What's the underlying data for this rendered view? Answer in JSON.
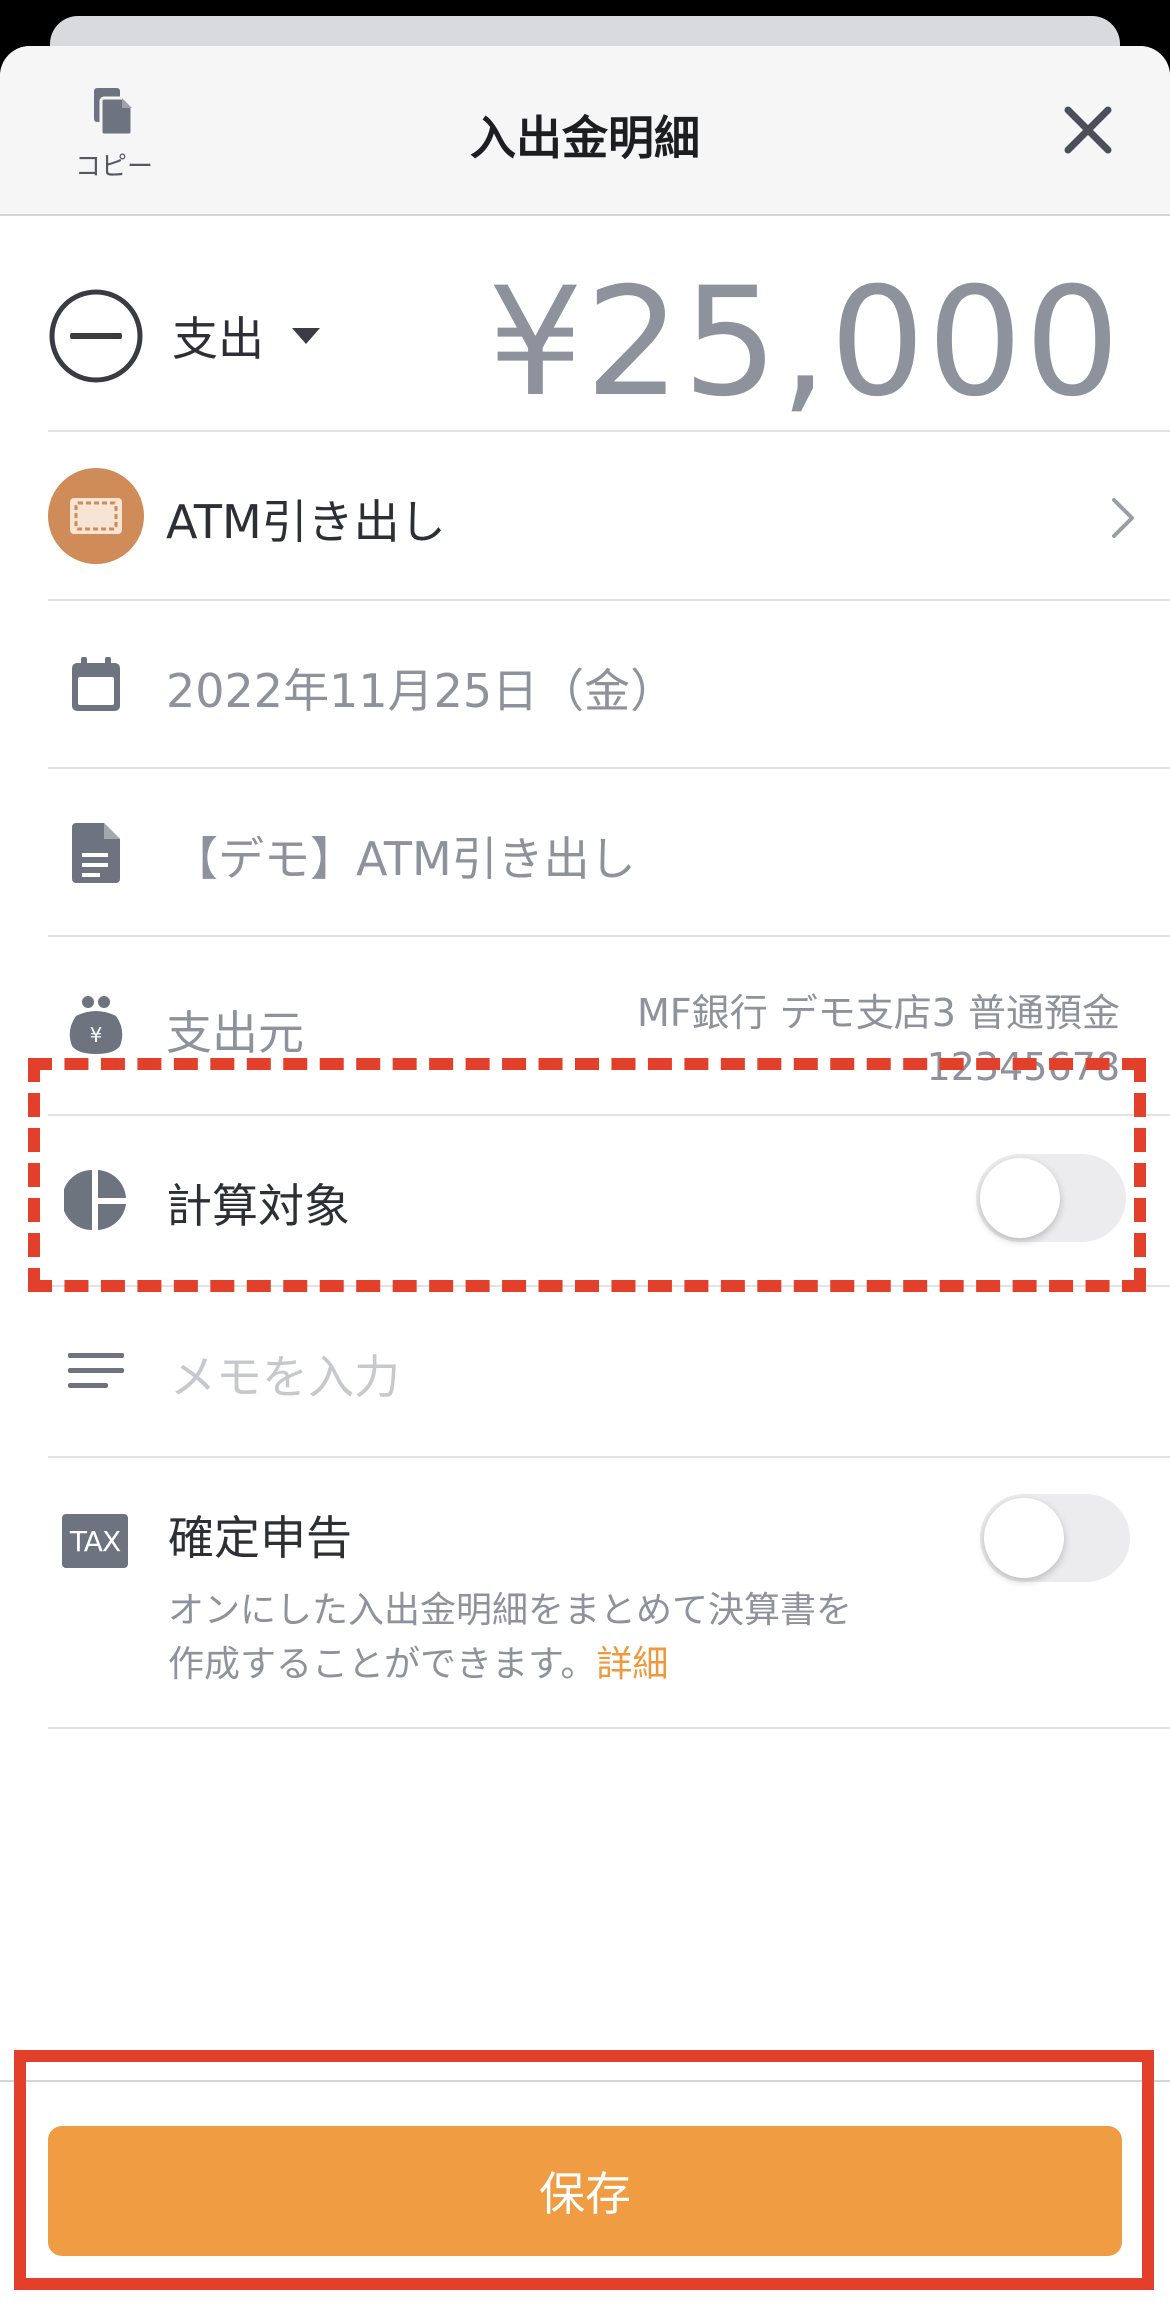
{
  "header": {
    "title": "入出金明細",
    "copy_label": "コピー"
  },
  "entry": {
    "type_label": "支出",
    "amount": "¥25,000"
  },
  "category": {
    "label": "ATM引き出し",
    "icon_color": "#cf8c58"
  },
  "date": {
    "value": "2022年11月25日（金）"
  },
  "content": {
    "value": "【デモ】ATM引き出し"
  },
  "source": {
    "label": "支出元",
    "account_line1": "MF銀行 デモ支店3 普通預金",
    "account_line2": "12345678"
  },
  "calc_target": {
    "label": "計算対象",
    "enabled": false
  },
  "memo": {
    "placeholder": "メモを入力"
  },
  "tax": {
    "badge": "TAX",
    "label": "確定申告",
    "enabled": false,
    "desc_line1": "オンにした入出金明細をまとめて決算書を",
    "desc_line2": "作成することができます。",
    "link": "詳細"
  },
  "footer": {
    "save_label": "保存"
  },
  "colors": {
    "accent": "#ef9c43",
    "highlight": "#e2402b",
    "muted_text": "#8d929c"
  }
}
